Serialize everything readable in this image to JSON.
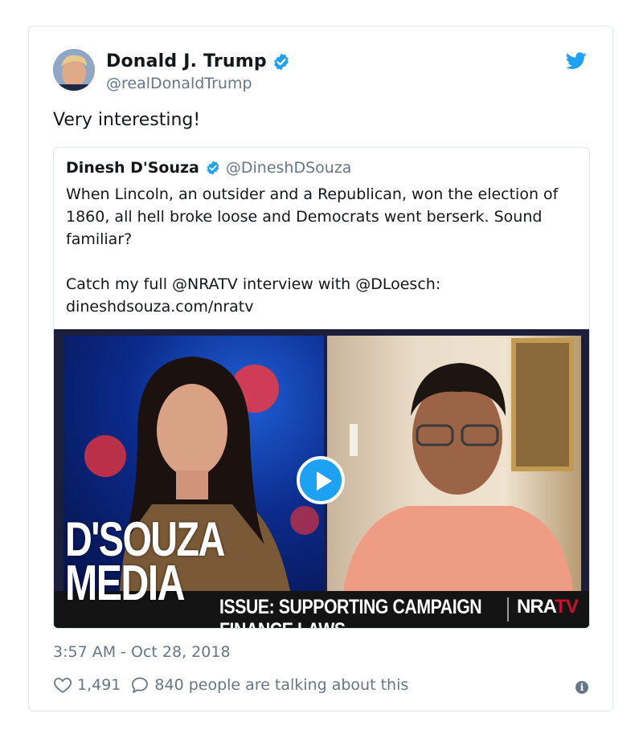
{
  "tweet": {
    "display_name": "Donald J. Trump",
    "handle": "@realDonaldTrump",
    "text": "Very interesting!",
    "timestamp": "3:57 AM - Oct 28, 2018",
    "likes": "1,491",
    "conversation": "840 people are talking about this",
    "brand_color": "#1da1f2"
  },
  "quoted": {
    "display_name": "Dinesh D'Souza",
    "handle": "@DineshDSouza",
    "text": "When Lincoln, an outsider and a Republican, won the election of 1860, all hell broke loose and Democrats went berserk. Sound familiar?\n\nCatch my full @NRATV interview with @DLoesch:\ndineshdsouza.com/nratv"
  },
  "video": {
    "lower_third": "ISSUE: SUPPORTING CAMPAIGN FINANCE LAWS",
    "network_prefix": "NRA",
    "network_suffix": "TV",
    "watermark_line1": "D'SOUZA",
    "watermark_line2": "MEDIA"
  },
  "icons": {
    "brand": "twitter-bird-icon",
    "verified": "verified-badge-icon",
    "play": "play-icon",
    "like": "heart-icon",
    "reply": "speech-bubble-icon",
    "info": "info-icon"
  }
}
